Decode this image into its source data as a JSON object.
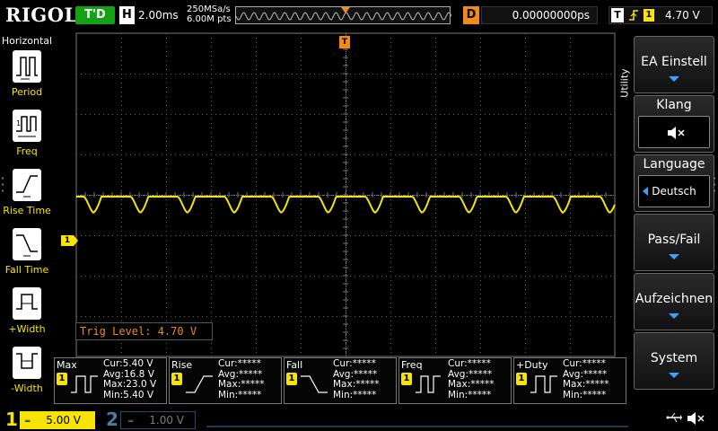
{
  "topbar": {
    "brand": "RIGOL",
    "run_state": "T'D",
    "h_label": "H",
    "timebase": "2.00ms",
    "sample_rate": "250MSa/s",
    "memory_depth": "6.00M pts",
    "d_label": "D",
    "delay": "0.00000000ps",
    "t_label": "T",
    "trigger_source": "1",
    "trigger_level": "4.70 V"
  },
  "left_panel": {
    "title": "Horizontal",
    "buttons": [
      {
        "label": "Period",
        "icon": "period-icon"
      },
      {
        "label": "Freq",
        "icon": "freq-icon"
      },
      {
        "label": "Rise Time",
        "icon": "rise-time-icon"
      },
      {
        "label": "Fall Time",
        "icon": "fall-time-icon"
      },
      {
        "label": "+Width",
        "icon": "plus-width-icon"
      },
      {
        "label": "-Width",
        "icon": "minus-width-icon"
      }
    ]
  },
  "display": {
    "ch1_marker": "1",
    "trigger_level_marker": "T",
    "trigger_position_marker": "T",
    "trig_level_text": "Trig Level: 4.70 V",
    "trace_color": "#f7e400",
    "trigger_color": "#f28a1a"
  },
  "right_menu": {
    "tab": "Utility",
    "buttons": [
      {
        "label": "EA Einstell",
        "kind": "dropdown"
      },
      {
        "label": "Klang",
        "kind": "speaker"
      },
      {
        "label": "Language",
        "value": "Deutsch",
        "kind": "select"
      },
      {
        "label": "Pass/Fail",
        "kind": "dropdown"
      },
      {
        "label": "Aufzeichnen",
        "kind": "dropdown"
      },
      {
        "label": "System",
        "kind": "dropdown"
      }
    ]
  },
  "measurements": [
    {
      "name": "Max",
      "ch": "1",
      "cur": "Cur:5.40 V",
      "avg": "Avg:16.8 V",
      "max": "Max:23.0 V",
      "min": "Min:5.40 V"
    },
    {
      "name": "Rise",
      "ch": "1",
      "cur": "Cur:*****",
      "avg": "Avg:*****",
      "max": "Max:*****",
      "min": "Min:*****"
    },
    {
      "name": "Fall",
      "ch": "1",
      "cur": "Cur:*****",
      "avg": "Avg:*****",
      "max": "Max:*****",
      "min": "Min:*****"
    },
    {
      "name": "Freq",
      "ch": "1",
      "cur": "Cur:*****",
      "avg": "Avg:*****",
      "max": "Max:*****",
      "min": "Min:*****"
    },
    {
      "name": "+Duty",
      "ch": "1",
      "cur": "Cur:*****",
      "avg": "Avg:*****",
      "max": "Max:*****",
      "min": "Min:*****"
    }
  ],
  "bottombar": {
    "ch1_num": "1",
    "ch1_scale": "5.00 V",
    "ch2_num": "2",
    "ch2_scale": "1.00 V"
  }
}
